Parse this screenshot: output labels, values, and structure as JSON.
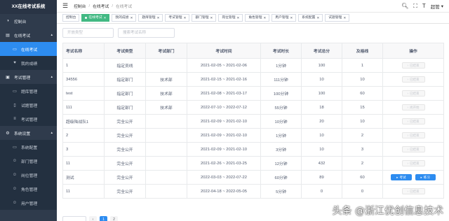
{
  "app": {
    "title": "XX在线考试系统"
  },
  "sidebar": {
    "items": [
      {
        "label": "控制台",
        "icon": "dashboard-icon",
        "level": 0,
        "active": false
      },
      {
        "label": "在线考试",
        "icon": "exam-icon",
        "level": 0,
        "active": false,
        "expanded": true
      },
      {
        "label": "在线考试",
        "icon": "monitor-icon",
        "level": 1,
        "active": true
      },
      {
        "label": "我的成绩",
        "icon": "heart-icon",
        "level": 1,
        "active": false
      },
      {
        "label": "考试管理",
        "icon": "briefcase-icon",
        "level": 0,
        "active": false,
        "expanded": true
      },
      {
        "label": "题库管理",
        "icon": "monitor-icon",
        "level": 1,
        "active": false
      },
      {
        "label": "试题管理",
        "icon": "document-icon",
        "level": 1,
        "active": false
      },
      {
        "label": "考试管理",
        "icon": "list-icon",
        "level": 1,
        "active": false
      },
      {
        "label": "系统设置",
        "icon": "gear-icon",
        "level": 0,
        "active": false,
        "expanded": true
      },
      {
        "label": "系统配置",
        "icon": "monitor-icon",
        "level": 1,
        "active": false
      },
      {
        "label": "部门管理",
        "icon": "user-icon",
        "level": 1,
        "active": false
      },
      {
        "label": "岗位管理",
        "icon": "user-icon",
        "level": 1,
        "active": false
      },
      {
        "label": "角色管理",
        "icon": "user-icon",
        "level": 1,
        "active": false
      },
      {
        "label": "用户管理",
        "icon": "user-icon",
        "level": 1,
        "active": false
      }
    ]
  },
  "header": {
    "breadcrumb": [
      "控制台",
      "在线考试",
      "在线考试"
    ],
    "username": "超管"
  },
  "tags": [
    {
      "label": "控制台",
      "active": false,
      "closable": false
    },
    {
      "label": "在线考试",
      "active": true,
      "closable": true
    },
    {
      "label": "我的成绩",
      "active": false,
      "closable": true
    },
    {
      "label": "题库管理",
      "active": false,
      "closable": true
    },
    {
      "label": "考试管理",
      "active": false,
      "closable": true
    },
    {
      "label": "部门管理",
      "active": false,
      "closable": true
    },
    {
      "label": "岗位管理",
      "active": false,
      "closable": true
    },
    {
      "label": "角色管理",
      "active": false,
      "closable": true
    },
    {
      "label": "用户管理",
      "active": false,
      "closable": true
    },
    {
      "label": "系统配置",
      "active": false,
      "closable": true
    },
    {
      "label": "试题管理",
      "active": false,
      "closable": true
    }
  ],
  "filters": {
    "type_placeholder": "开放类型",
    "search_placeholder": "搜索考试名称"
  },
  "table": {
    "columns": [
      "考试名称",
      "考试类型",
      "考试部门",
      "考试时间",
      "考试时长",
      "考试总分",
      "及格线",
      "操作"
    ],
    "rows": [
      {
        "name": "1",
        "type": "指定员线",
        "dept": "",
        "time": "2021-02-05 ~ 2021-02-06",
        "duration": "1分钟",
        "total": "100",
        "pass": "1",
        "ops": [
          {
            "label": "已结束",
            "kind": "disabled"
          }
        ]
      },
      {
        "name": "34556",
        "type": "指定部门",
        "dept": "技术部",
        "time": "2021-02-15 ~ 2021-02-16",
        "duration": "111分钟",
        "total": "10",
        "pass": "10",
        "ops": [
          {
            "label": "已结束",
            "kind": "disabled"
          }
        ]
      },
      {
        "name": "test",
        "type": "指定部门",
        "dept": "技术部",
        "time": "2021-02-08 ~ 2021-03-17",
        "duration": "100分钟",
        "total": "100",
        "pass": "60",
        "ops": [
          {
            "label": "已结束",
            "kind": "disabled"
          }
        ]
      },
      {
        "name": "111",
        "type": "指定部门",
        "dept": "技术部",
        "time": "2022-07-10 ~ 2022-07-12",
        "duration": "55分钟",
        "total": "18",
        "pass": "15",
        "ops": [
          {
            "label": "尚开始",
            "kind": "disabled"
          }
        ]
      },
      {
        "name": "超级陆战队1",
        "type": "完全公开",
        "dept": "",
        "time": "2021-02-09 ~ 2021-02-10",
        "duration": "10分钟",
        "total": "20",
        "pass": "10",
        "ops": [
          {
            "label": "已结束",
            "kind": "disabled"
          }
        ]
      },
      {
        "name": "2",
        "type": "完全公开",
        "dept": "",
        "time": "2021-02-09 ~ 2021-02-10",
        "duration": "1分钟",
        "total": "10",
        "pass": "2",
        "ops": [
          {
            "label": "已结束",
            "kind": "disabled"
          }
        ]
      },
      {
        "name": "3",
        "type": "完全公开",
        "dept": "",
        "time": "2021-02-09 ~ 2021-02-10",
        "duration": "3分钟",
        "total": "10",
        "pass": "3",
        "ops": [
          {
            "label": "已结束",
            "kind": "disabled"
          }
        ]
      },
      {
        "name": "11",
        "type": "完全公开",
        "dept": "",
        "time": "2021-02-26 ~ 2021-03-25",
        "duration": "12分钟",
        "total": "432",
        "pass": "2",
        "ops": [
          {
            "label": "已结束",
            "kind": "disabled"
          }
        ]
      },
      {
        "name": "测试",
        "type": "完全公开",
        "dept": "",
        "time": "2022-03-03 ~ 2022-07-22",
        "duration": "60分钟",
        "total": "89",
        "pass": "60",
        "ops": [
          {
            "label": "考试",
            "kind": "primary"
          },
          {
            "label": "练习",
            "kind": "primary"
          }
        ]
      },
      {
        "name": "11",
        "type": "完全公开",
        "dept": "",
        "time": "2022-04-18 ~ 2022-05-05",
        "duration": "5分钟",
        "total": "0",
        "pass": "0",
        "ops": [
          {
            "label": "已结束",
            "kind": "disabled"
          }
        ]
      }
    ]
  },
  "pagination": {
    "pages": [
      "1",
      "2"
    ],
    "current": "1"
  },
  "watermark": "头条 @浙江优创信息技术",
  "colors": {
    "sidebar_bg": "#2f3b4c",
    "accent": "#2d8cf0",
    "active_tag": "#42b983"
  }
}
